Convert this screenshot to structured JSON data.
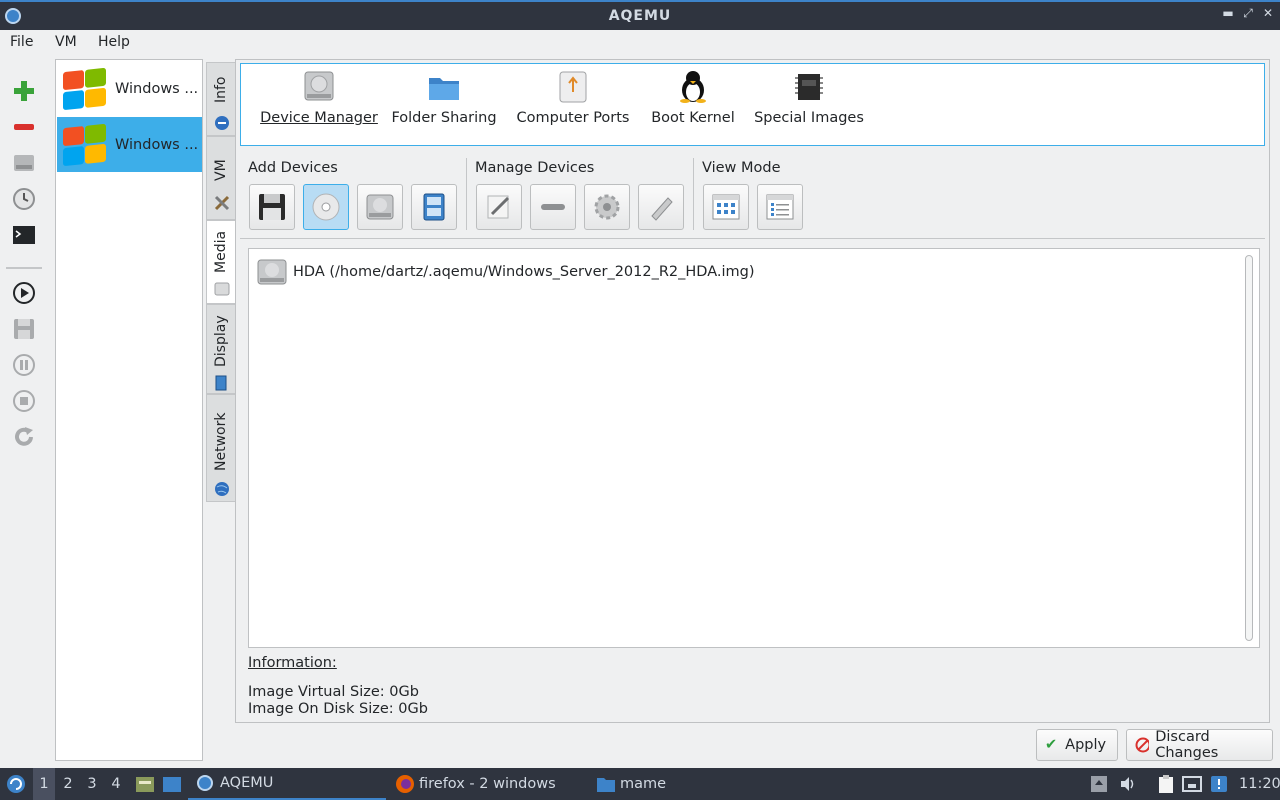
{
  "window": {
    "title": "AQEMU"
  },
  "menu": [
    "File",
    "VM",
    "Help"
  ],
  "toolbar": {
    "items": [
      "add-vm",
      "remove-vm",
      "hdd",
      "clock",
      "terminal",
      "play",
      "save",
      "pause",
      "stop",
      "reload"
    ]
  },
  "vm_list": [
    {
      "label": "Windows ...",
      "selected": false
    },
    {
      "label": "Windows ...",
      "selected": true
    }
  ],
  "side_tabs": [
    "Info",
    "VM",
    "Media",
    "Display",
    "Network"
  ],
  "active_side_tab": "Media",
  "pages": [
    {
      "label": "Device Manager",
      "icon": "hdd-icon",
      "active": true
    },
    {
      "label": "Folder Sharing",
      "icon": "folder-icon",
      "active": false
    },
    {
      "label": "Computer Ports",
      "icon": "usb-icon",
      "active": false
    },
    {
      "label": "Boot Kernel",
      "icon": "tux-icon",
      "active": false
    },
    {
      "label": "Special Images",
      "icon": "chip-icon",
      "active": false
    }
  ],
  "groups": {
    "add_devices": "Add Devices",
    "manage_devices": "Manage Devices",
    "view_mode": "View Mode"
  },
  "devices": [
    {
      "label": "HDA (/home/dartz/.aqemu/Windows_Server_2012_R2_HDA.img)",
      "icon": "hdd-icon"
    }
  ],
  "info": {
    "title": "Information:",
    "virtual_size": "Image Virtual Size: 0Gb",
    "disk_size": "Image On Disk Size: 0Gb"
  },
  "buttons": {
    "apply": "Apply",
    "discard": "Discard Changes"
  },
  "taskbar": {
    "workspaces": [
      "1",
      "2",
      "3",
      "4"
    ],
    "active_workspace": "1",
    "tasks": [
      "AQEMU",
      "firefox - 2 windows",
      "mame"
    ],
    "clock": "11:20"
  },
  "colors": {
    "accent": "#3daee9",
    "titlebar": "#2f343f"
  }
}
